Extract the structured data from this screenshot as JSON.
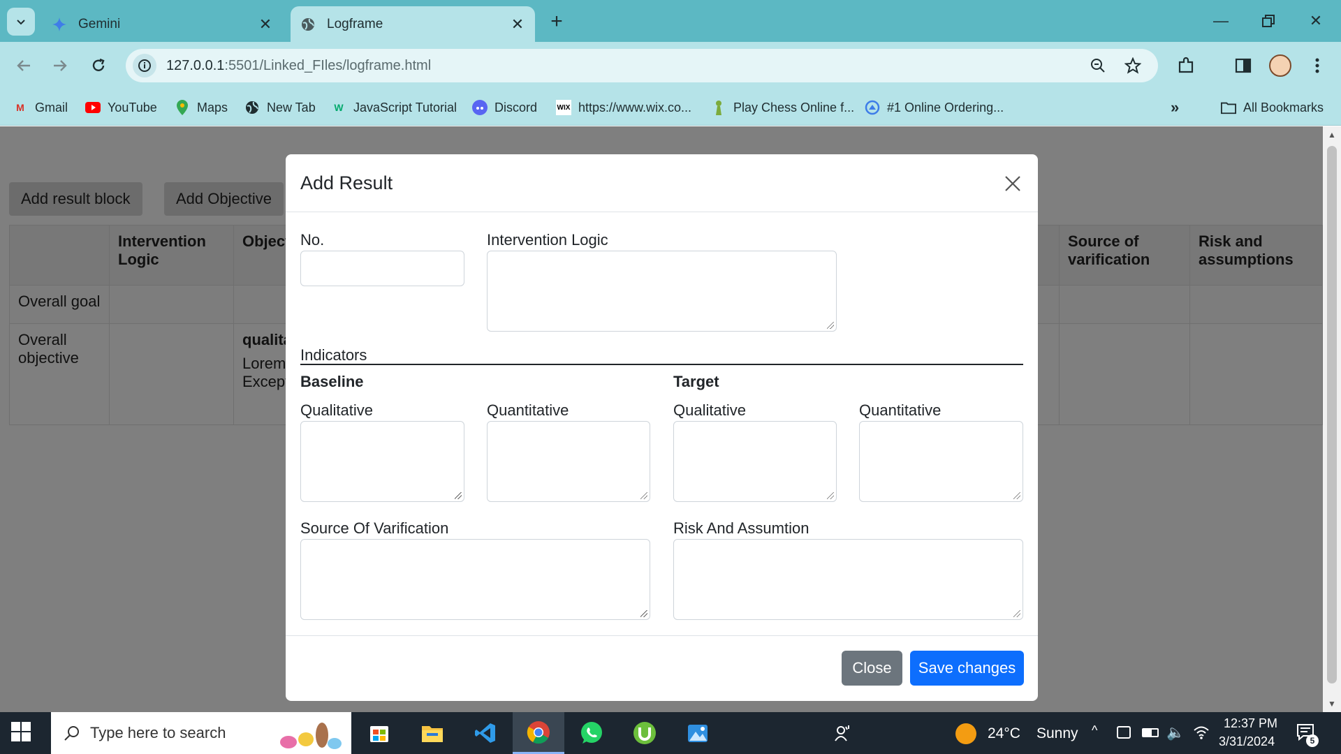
{
  "browser": {
    "tabs": [
      {
        "title": "Gemini",
        "icon": "gemini-sparkle-icon",
        "active": false
      },
      {
        "title": "Logframe",
        "icon": "globe-icon",
        "active": true
      }
    ],
    "url_host": "127.0.0.1",
    "url_path": ":5501/Linked_FIles/logframe.html",
    "bookmarks": [
      {
        "label": "Gmail",
        "icon": "gmail-icon"
      },
      {
        "label": "YouTube",
        "icon": "youtube-icon"
      },
      {
        "label": "Maps",
        "icon": "maps-pin-icon"
      },
      {
        "label": "New Tab",
        "icon": "globe-icon"
      },
      {
        "label": "JavaScript Tutorial",
        "icon": "w3schools-icon"
      },
      {
        "label": "Discord",
        "icon": "discord-icon"
      },
      {
        "label": "https://www.wix.co...",
        "icon": "wix-icon"
      },
      {
        "label": "Play Chess Online f...",
        "icon": "chess-pawn-icon"
      },
      {
        "label": "#1 Online Ordering...",
        "icon": "ordering-icon"
      }
    ],
    "all_bookmarks": "All Bookmarks"
  },
  "page": {
    "buttons": {
      "add_result_block": "Add result block",
      "add_objective": "Add Objective"
    },
    "table": {
      "headers": [
        "",
        "Intervention Logic",
        "Object",
        "Source of varification",
        "Risk and assumptions"
      ],
      "rows": [
        {
          "label": "Overall goal",
          "col2": "",
          "col3": ""
        },
        {
          "label": "Overall objective",
          "col2": "",
          "col3_bold": "qualita",
          "col3_text": "Lorem Except"
        }
      ]
    }
  },
  "modal": {
    "title": "Add Result",
    "fields": {
      "no": {
        "label": "No.",
        "value": ""
      },
      "intervention_logic": {
        "label": "Intervention Logic",
        "value": ""
      },
      "indicators": "Indicators",
      "baseline": "Baseline",
      "target": "Target",
      "baseline_qualitative": {
        "label": "Qualitative",
        "value": ""
      },
      "baseline_quantitative": {
        "label": "Quantitative",
        "value": ""
      },
      "target_qualitative": {
        "label": "Qualitative",
        "value": ""
      },
      "target_quantitative": {
        "label": "Quantitative",
        "value": ""
      },
      "source": {
        "label": "Source Of Varification",
        "value": ""
      },
      "risk": {
        "label": "Risk And Assumtion",
        "value": ""
      }
    },
    "buttons": {
      "close": "Close",
      "save": "Save changes"
    }
  },
  "taskbar": {
    "search_placeholder": "Type here to search",
    "apps": [
      "microsoft-store-icon",
      "file-explorer-icon",
      "vscode-icon",
      "chrome-icon",
      "whatsapp-icon",
      "utorrent-icon",
      "photos-icon"
    ],
    "weather": {
      "temp": "24°C",
      "condition": "Sunny"
    },
    "time": "12:37 PM",
    "date": "3/31/2024",
    "notifications": "5"
  },
  "colors": {
    "chrome_frame": "#5cb8c3",
    "chrome_toolbar": "#b5e3e8",
    "primary_button": "#0d6efd",
    "secondary_button": "#6c757d"
  }
}
